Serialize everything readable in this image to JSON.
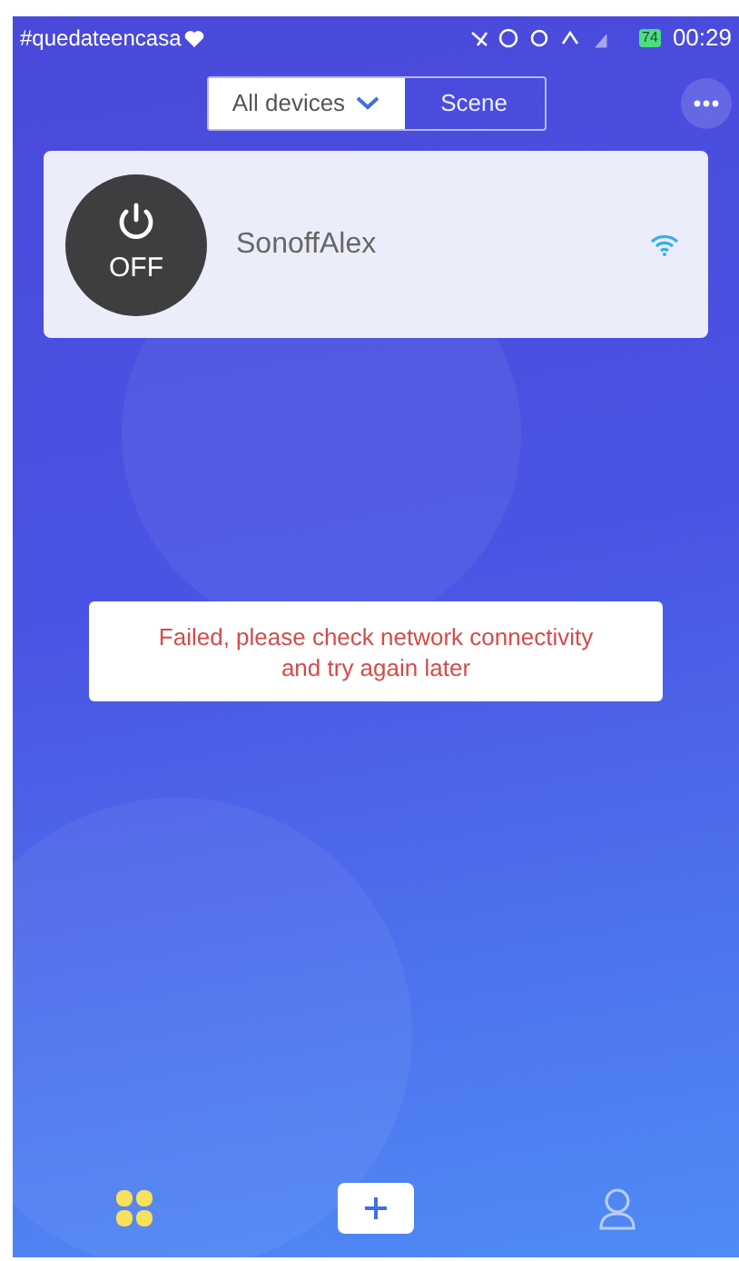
{
  "status_bar": {
    "hashtag": "#quedateencasa",
    "battery": "74",
    "time": "00:29"
  },
  "segments": [
    {
      "label": "All devices",
      "selected": true,
      "kind": "dropdown"
    },
    {
      "label": "Scene",
      "selected": false,
      "kind": "plain"
    }
  ],
  "device": {
    "name": "SonoffAlex",
    "on": false,
    "power_label": "OFF"
  },
  "toast": {
    "text": "Failed, please check network connectivity and try again later"
  },
  "nav": [
    {
      "kind": "home",
      "selected": true
    },
    {
      "kind": "add",
      "selected": false
    },
    {
      "kind": "profile",
      "selected": false
    }
  ]
}
